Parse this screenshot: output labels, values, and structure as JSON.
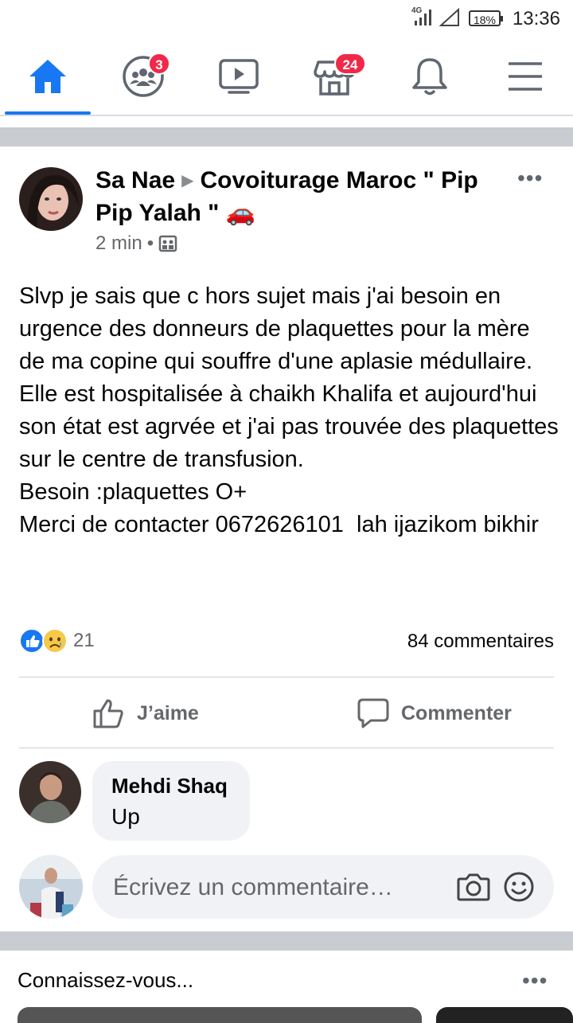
{
  "status_bar": {
    "network": "4G",
    "battery": "18%",
    "time": "13:36"
  },
  "nav": {
    "friends_badge": "3",
    "marketplace_badge": "24"
  },
  "post": {
    "author": "Sa Nae",
    "group": "Covoiturage Maroc \" Pip Pip Yalah \" 🚗",
    "time": "2 min",
    "body": "Slvp je sais que c hors sujet mais j'ai besoin en urgence des donneurs de plaquettes pour la mère de ma copine qui souffre d'une aplasie médullaire. Elle est hospitalisée à chaikh Khalifa et aujourd'hui son état est agrvée et j'ai pas trouvée des plaquettes sur le centre de transfusion.\nBesoin :plaquettes O+\nMerci de contacter 0672626101  lah ijazikom bikhir",
    "reaction_count": "21",
    "comment_count": "84 commentaires",
    "like_label": "J’aime",
    "comment_label": "Commenter"
  },
  "comment": {
    "name": "Mehdi Shaq",
    "text": "Up"
  },
  "composer": {
    "placeholder": "Écrivez un commentaire…"
  },
  "pymk": {
    "title": "Connaissez-vous..."
  },
  "colors": {
    "accent": "#1877f2",
    "badge": "#f02849",
    "separator": "#c9ccd1"
  }
}
